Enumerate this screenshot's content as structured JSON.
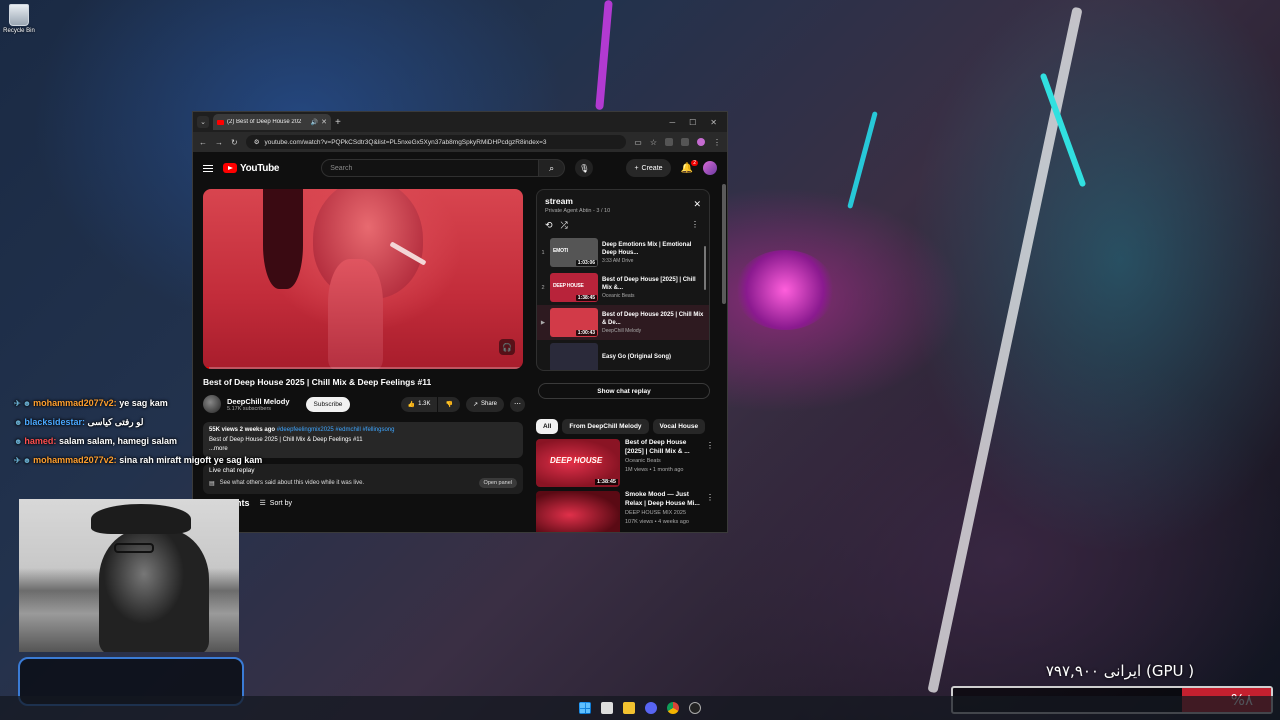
{
  "desktop": {
    "recycle_bin": "Recycle Bin"
  },
  "browser": {
    "tab_title": "(2) Best of Deep House 202",
    "url": "youtube.com/watch?v=PQPkCSdtr3Q&list=PL5nxeGx5Xyn37ab8mgSpkyRMiDHPcdgzR8index=3"
  },
  "youtube": {
    "logo_text": "YouTube",
    "search_placeholder": "Search",
    "create_label": "Create",
    "notif_count": "2",
    "video": {
      "title": "Best of Deep House 2025 | Chill Mix & Deep Feelings #11",
      "channel": "DeepChill Melody",
      "subscribers": "5.17K subscribers",
      "subscribe_label": "Subscribe",
      "likes": "1.3K",
      "share_label": "Share",
      "views_date": "55K views  2 weeks ago",
      "tags": "#deepfeelingmix2025 #edmchill #fellingsong",
      "description": "Best of Deep House 2025 | Chill Mix & Deep Feelings #11",
      "more": "...more",
      "progress": 0.02
    },
    "chat_replay": {
      "heading": "Live chat replay",
      "text": "See what others said about this video while it was live.",
      "open_label": "Open panel"
    },
    "comments": {
      "heading": "Comments",
      "sort_label": "Sort by"
    },
    "playlist": {
      "title": "stream",
      "subtitle": "Private  Agent Abtin - 3 / 10",
      "items": [
        {
          "idx": "1",
          "title": "Deep Emotions Mix | Emotional Deep Hous...",
          "channel": "3:33 AM Drive",
          "duration": "1:03:06",
          "thumb_text": "EMOTI",
          "thumb_color": "#555555"
        },
        {
          "idx": "2",
          "title": "Best of Deep House [2025] | Chill Mix &...",
          "channel": "Oceanic Beats",
          "duration": "1:38:45",
          "thumb_text": "DEEP HOUSE",
          "thumb_color": "#b8233a"
        },
        {
          "idx": "▶",
          "title": "Best of Deep House 2025 | Chill Mix & De...",
          "channel": "DeepChill Melody",
          "duration": "1:00:43",
          "thumb_text": "",
          "thumb_color": "#d23a48"
        },
        {
          "idx": "",
          "title": "Easy Go (Original Song)",
          "channel": "",
          "duration": "",
          "thumb_text": "",
          "thumb_color": "#2a2a3a"
        }
      ]
    },
    "show_chat_label": "Show chat replay",
    "chips": [
      "All",
      "From DeepChill Melody",
      "Vocal House"
    ],
    "recommendations": [
      {
        "title": "Best of Deep House [2025] | Chill Mix & ...",
        "channel": "Oceanic Beats",
        "meta": "1M views • 1 month ago",
        "duration": "1:38:45",
        "thumb_label": "DEEP HOUSE",
        "thumb_color": "#8a1424"
      },
      {
        "title": "Smoke Mood — Just Relax | Deep House Mi...",
        "channel": "DEEP HOUSE MIX 2025",
        "meta": "107K views • 4 weeks ago",
        "duration": "",
        "thumb_label": "",
        "thumb_color": "#5a0a14"
      }
    ]
  },
  "stream_chat": [
    {
      "user": "mohammad2077v2:",
      "msg": "ye sag kam",
      "color": "u1",
      "icon": "✈"
    },
    {
      "user": "blacksidestar:",
      "msg": "لو رفتی کیاسی",
      "color": "u2",
      "icon": ""
    },
    {
      "user": "hamed:",
      "msg": "salam salam, hamegi salam",
      "color": "u3",
      "icon": ""
    },
    {
      "user": "mohammad2077v2:",
      "msg": "sina rah miraft migoft ye sag kam",
      "color": "u1",
      "icon": "✈"
    }
  ],
  "donation": {
    "text": "( GPU) ایرانی ۷۹۷,۹۰۰",
    "percent_label": "%۸",
    "progress": 0.08,
    "fill_color": "#c4202f"
  }
}
